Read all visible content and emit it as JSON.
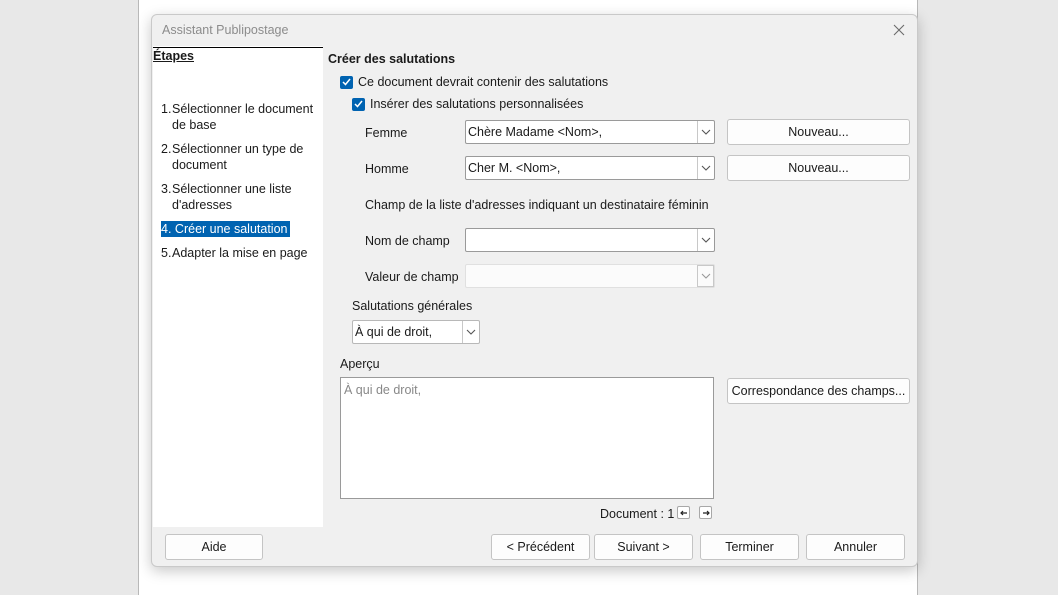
{
  "dialog": {
    "title": "Assistant Publipostage"
  },
  "steps": {
    "heading": "Étapes",
    "items": [
      {
        "num": "1.",
        "label": "Sélectionner le document de base"
      },
      {
        "num": "2.",
        "label": "Sélectionner un type de document"
      },
      {
        "num": "3.",
        "label": "Sélectionner une liste d'adresses"
      },
      {
        "num": "4.",
        "label": "Créer une salutation",
        "active": true
      },
      {
        "num": "5.",
        "label": "Adapter la mise en page"
      }
    ]
  },
  "content": {
    "section_title": "Créer des salutations",
    "checkbox_contains": {
      "label": "Ce document devrait contenir des salutations",
      "checked": true
    },
    "checkbox_personalized": {
      "label": "Insérer des salutations personnalisées",
      "checked": true
    },
    "female": {
      "label": "Femme",
      "value": "Chère Madame <Nom>,",
      "new_button": "Nouveau..."
    },
    "male": {
      "label": "Homme",
      "value": "Cher M. <Nom>,",
      "new_button": "Nouveau..."
    },
    "field_info": "Champ de la liste d'adresses indiquant un destinataire féminin",
    "field_name": {
      "label": "Nom de champ",
      "value": ""
    },
    "field_value": {
      "label": "Valeur de champ",
      "value": ""
    },
    "general": {
      "label": "Salutations générales",
      "value": "À qui de droit,"
    },
    "preview": {
      "label": "Aperçu",
      "text": "À qui de droit,"
    },
    "match_fields_button": "Correspondance des champs...",
    "document_label": "Document : 1"
  },
  "footer": {
    "help": "Aide",
    "previous": "< Précédent",
    "next": "Suivant >",
    "finish": "Terminer",
    "cancel": "Annuler"
  },
  "colors": {
    "accent": "#0063b1"
  }
}
